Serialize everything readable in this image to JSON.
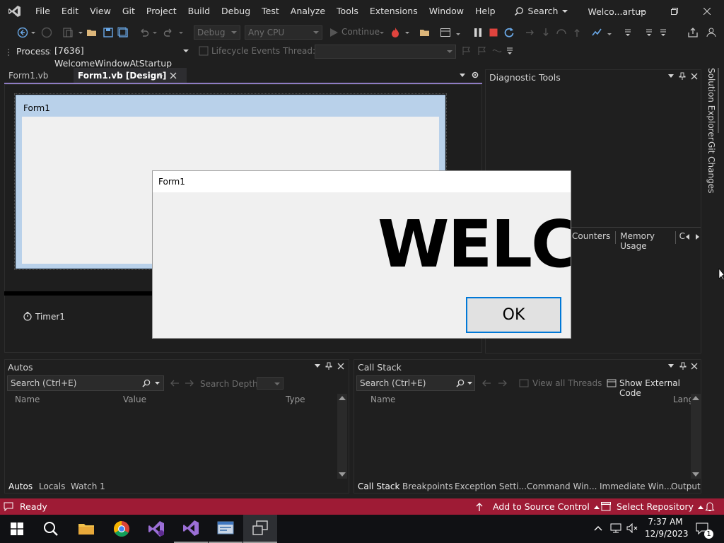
{
  "menubar": {
    "items": [
      "File",
      "Edit",
      "View",
      "Git",
      "Project",
      "Build",
      "Debug",
      "Test",
      "Analyze",
      "Tools",
      "Extensions",
      "Window",
      "Help"
    ],
    "search_label": "Search",
    "window_title": "Welco...artup"
  },
  "toolbar": {
    "config": "Debug",
    "platform": "Any CPU",
    "continue_label": "Continue"
  },
  "debug_location": {
    "process_label": "Process:",
    "process_value": "[7636] WelcomeWindowAtStartup",
    "lifecycle_label": "Lifecycle Events",
    "thread_label": "Thread:"
  },
  "tabs": {
    "tab1": "Form1.vb",
    "tab2": "Form1.vb [Design]"
  },
  "designer": {
    "form_caption": "Form1",
    "component_label": "Timer1"
  },
  "diagnostic": {
    "title": "Diagnostic Tools",
    "subtabs": [
      "Counters",
      "Memory Usage",
      "C"
    ]
  },
  "rail": {
    "solution_explorer": "Solution Explorer",
    "git_changes": "Git Changes"
  },
  "dialog": {
    "title": "Form1",
    "message": "WELCOME",
    "ok_label": "OK"
  },
  "autos": {
    "title": "Autos",
    "search_placeholder": "Search (Ctrl+E)",
    "search_depth_label": "Search Depth:",
    "columns": [
      "Name",
      "Value",
      "Type"
    ],
    "tabs": [
      "Autos",
      "Locals",
      "Watch 1"
    ]
  },
  "callstack": {
    "title": "Call Stack",
    "search_placeholder": "Search (Ctrl+E)",
    "view_threads_label": "View all Threads",
    "show_external_label": "Show External Code",
    "columns": [
      "Name",
      "Lang"
    ],
    "tabs": [
      "Call Stack",
      "Breakpoints",
      "Exception Setti...",
      "Command Win...",
      "Immediate Win...",
      "Output"
    ]
  },
  "statusbar": {
    "ready": "Ready",
    "source_control": "Add to Source Control",
    "select_repo": "Select Repository"
  },
  "taskbar": {
    "time": "7:37 AM",
    "date": "12/9/2023",
    "notification_count": "1"
  },
  "colors": {
    "accent_purple": "#8e7cc3",
    "status_bar": "#9e1b35",
    "dialog_button_border": "#0078d7"
  }
}
